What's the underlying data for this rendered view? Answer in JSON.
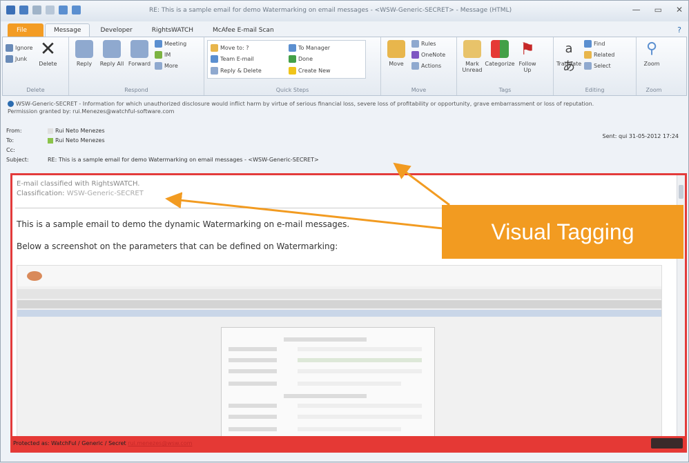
{
  "window": {
    "title": "RE: This is a sample email for demo Watermarking on email messages - <WSW-Generic-SECRET> - Message (HTML)",
    "controls": [
      "—",
      "▭",
      "✕"
    ]
  },
  "tabs": [
    "File",
    "Message",
    "Developer",
    "RightsWATCH",
    "McAfee E-mail Scan"
  ],
  "active_tab": "Message",
  "ribbon": {
    "delete": {
      "label": "Delete",
      "ignore": "Ignore",
      "junk": "Junk",
      "delete_btn": "Delete"
    },
    "respond": {
      "label": "Respond",
      "reply": "Reply",
      "reply_all": "Reply All",
      "forward": "Forward",
      "meeting": "Meeting",
      "im": "IM",
      "more": "More"
    },
    "quick_steps": {
      "label": "Quick Steps",
      "items": [
        "Move to: ?",
        "To Manager",
        "Team E-mail",
        "Done",
        "Reply & Delete",
        "Create New"
      ]
    },
    "move": {
      "label": "Move",
      "move_btn": "Move",
      "rules": "Rules",
      "onenote": "OneNote",
      "actions": "Actions"
    },
    "tags": {
      "label": "Tags",
      "mark_unread": "Mark Unread",
      "categorize": "Categorize",
      "follow_up": "Follow Up"
    },
    "editing": {
      "label": "Editing",
      "translate": "Translate",
      "find": "Find",
      "related": "Related",
      "select": "Select"
    },
    "zoom": {
      "label": "Zoom",
      "zoom_btn": "Zoom"
    }
  },
  "infobar": {
    "text": "WSW-Generic-SECRET - Information for which unauthorized disclosure would inflict harm by virtue of serious financial loss, severe loss of profitability or opportunity, grave embarrassment or loss of reputation.",
    "permission": "Permission granted by: rui.Menezes@watchful-software.com"
  },
  "header": {
    "from_label": "From:",
    "from": "Rui Neto Menezes",
    "to_label": "To:",
    "to": "Rui Neto Menezes",
    "cc_label": "Cc:",
    "subject_label": "Subject:",
    "subject": "RE: This is a sample email for demo Watermarking on email messages - <WSW-Generic-SECRET>",
    "sent": "Sent: qui 31-05-2012 17:24"
  },
  "body": {
    "classified_with": "E-mail classified with RightsWATCH.",
    "classification_label": "Classification:",
    "classification_value": "WSW-Generic-SECRET",
    "line1": "This is a sample email to demo the dynamic Watermarking on e-mail messages.",
    "line2": "Below a screenshot on the parameters that can be defined on Watermarking:"
  },
  "footer": {
    "text": "Protected as: WatchFul / Generic / Secret",
    "link": "rui.menezes@wsw.com"
  },
  "callout": {
    "text": "Visual Tagging"
  },
  "colors": {
    "accent": "#f29b21",
    "file_tab": "#f39c24",
    "border_red": "#e33b3b",
    "footer_red": "#e53935"
  }
}
